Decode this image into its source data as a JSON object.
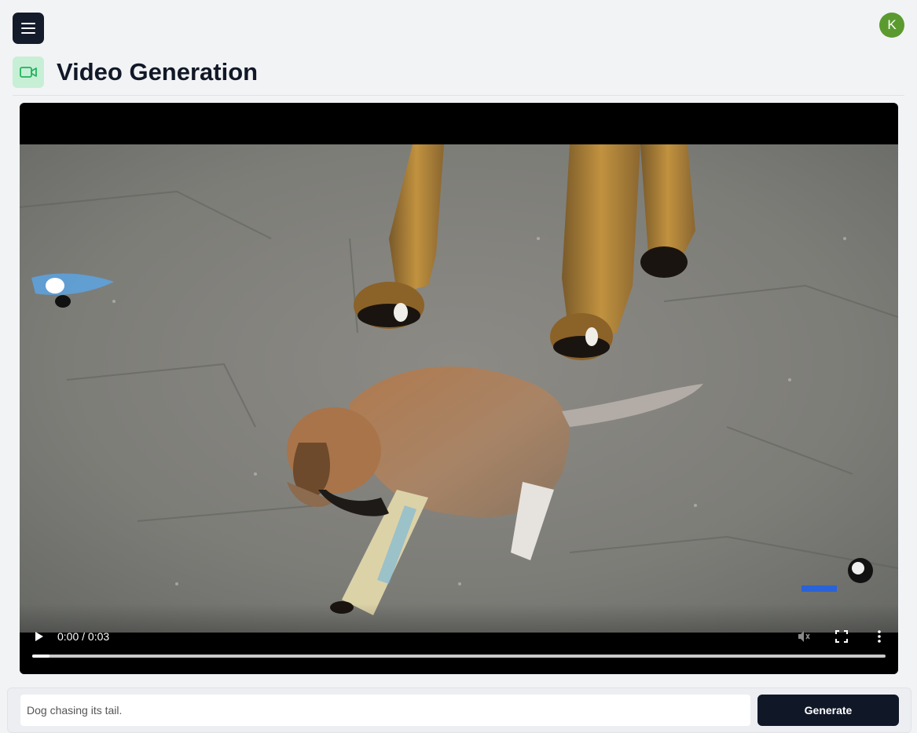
{
  "header": {
    "menu_icon": "hamburger-menu-icon",
    "avatar_initial": "K",
    "avatar_color": "#5b9a2f"
  },
  "page": {
    "title": "Video Generation",
    "title_icon": "video-camera-icon",
    "title_icon_bg": "#c7efd6",
    "title_icon_color": "#22b35e"
  },
  "video": {
    "time_display": "0:00 / 0:03",
    "progress": 0.02,
    "controls": {
      "play_icon": "play-icon",
      "mute_icon": "volume-muted-icon",
      "fullscreen_icon": "fullscreen-icon",
      "more_icon": "more-vertical-icon"
    }
  },
  "prompt": {
    "value": "Dog chasing its tail.",
    "button_label": "Generate"
  }
}
